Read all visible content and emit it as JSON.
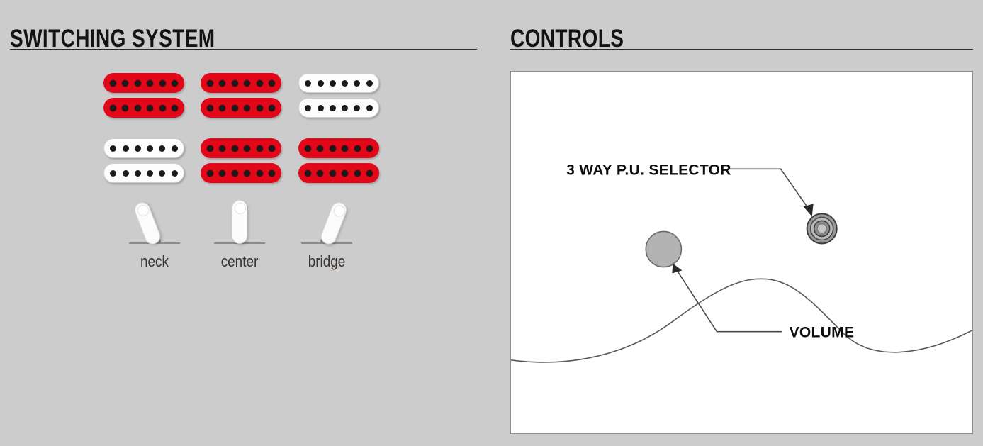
{
  "page": {
    "background_color": "#cccccc",
    "accent_red": "#e3071a",
    "label_color": "#3a332f",
    "rule_color": "#2b2b2b"
  },
  "switching": {
    "title": "SWITCHING SYSTEM",
    "pickups": [
      {
        "position": "row1-col1",
        "top_coil_color": "red",
        "bottom_coil_color": "red",
        "poles": 6
      },
      {
        "position": "row1-col2",
        "top_coil_color": "red",
        "bottom_coil_color": "red",
        "poles": 6
      },
      {
        "position": "row1-col3",
        "top_coil_color": "white",
        "bottom_coil_color": "white",
        "poles": 6
      },
      {
        "position": "row2-col1",
        "top_coil_color": "white",
        "bottom_coil_color": "white",
        "poles": 6
      },
      {
        "position": "row2-col2",
        "top_coil_color": "red",
        "bottom_coil_color": "red",
        "poles": 6
      },
      {
        "position": "row2-col3",
        "top_coil_color": "red",
        "bottom_coil_color": "red",
        "poles": 6
      }
    ],
    "switches": [
      {
        "label": "neck",
        "tilt": "left",
        "icon": "switch-lever-icon"
      },
      {
        "label": "center",
        "tilt": "vertical",
        "icon": "switch-lever-icon"
      },
      {
        "label": "bridge",
        "tilt": "right",
        "icon": "switch-lever-icon"
      }
    ]
  },
  "controls": {
    "title": "CONTROLS",
    "callouts": [
      {
        "label": "3 WAY P.U. SELECTOR",
        "target": "pickup-selector-switch"
      },
      {
        "label": "VOLUME",
        "target": "volume-knob"
      }
    ],
    "knob_color": "#b3b3b3",
    "body_outline_color": "#5a5a5a"
  }
}
